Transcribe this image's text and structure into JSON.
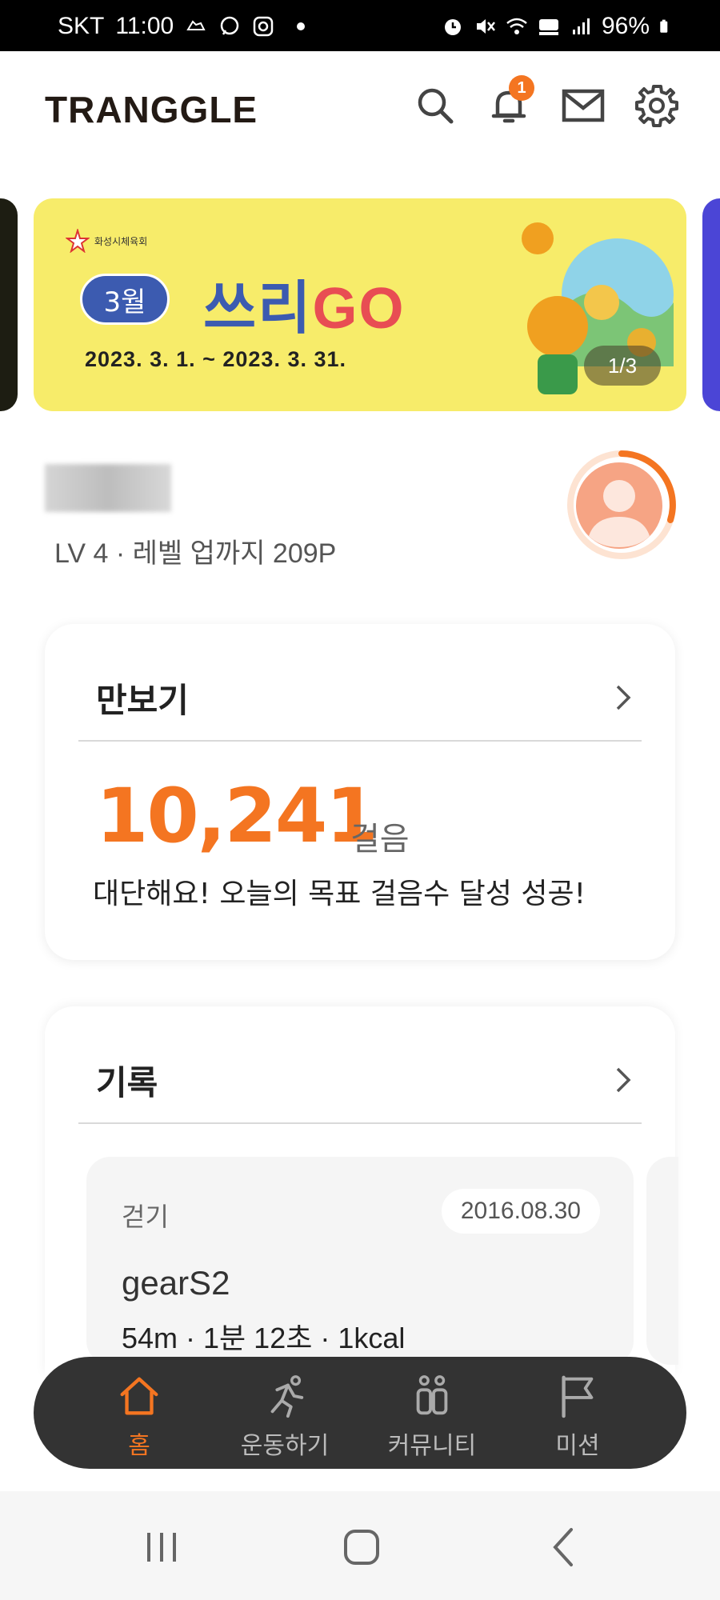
{
  "status_bar": {
    "carrier": "SKT",
    "time": "11:00",
    "battery": "96%"
  },
  "header": {
    "logo": "TRANGGLE",
    "notification_count": "1",
    "icons": [
      "search-icon",
      "bell-icon",
      "mail-icon",
      "gear-icon"
    ]
  },
  "banner": {
    "org": "화성시체육회",
    "month": "3월",
    "title_main": "쓰리",
    "title_go": "GO",
    "date_range": "2023. 3. 1. ~ 2023. 3. 31.",
    "counter": "1/3",
    "colors": {
      "background": "#f7ec6a",
      "accent_blue": "#3c5bb0",
      "accent_red": "#e84d53"
    }
  },
  "profile": {
    "level_text": "LV 4 · 레벨 업까지 209P",
    "level_progress": 0.3
  },
  "pedometer": {
    "title": "만보기",
    "steps": "10,241",
    "unit": "걸음",
    "message": "대단해요! 오늘의 목표 걸음수 달성 성공!"
  },
  "records": {
    "title": "기록",
    "item": {
      "type": "걷기",
      "date": "2016.08.30",
      "name": "gearS2",
      "stats": "54m · 1분 12초 · 1kcal"
    }
  },
  "bottom_nav": {
    "items": [
      {
        "label": "홈",
        "icon": "home-icon",
        "active": true
      },
      {
        "label": "운동하기",
        "icon": "running-icon",
        "active": false
      },
      {
        "label": "커뮤니티",
        "icon": "community-icon",
        "active": false
      },
      {
        "label": "미션",
        "icon": "flag-icon",
        "active": false
      }
    ]
  },
  "theme": {
    "accent": "#f47521",
    "nav_bg": "#333333"
  }
}
